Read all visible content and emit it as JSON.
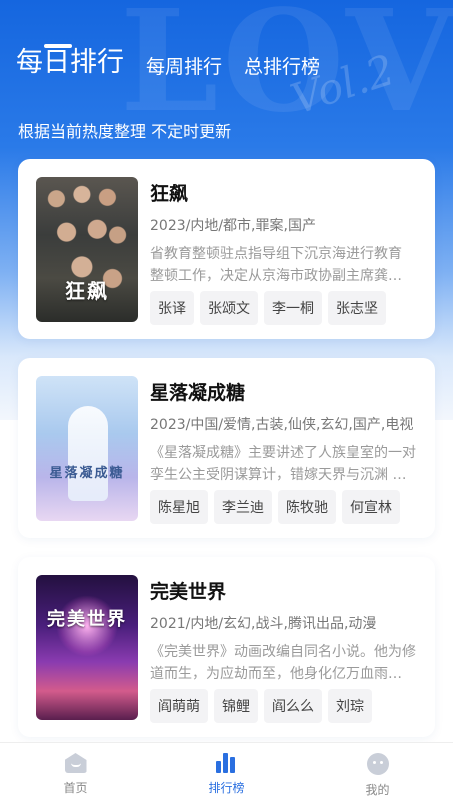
{
  "header": {
    "tabs": [
      {
        "label": "每日排行",
        "active": true
      },
      {
        "label": "每周排行",
        "active": false
      },
      {
        "label": "总排行榜",
        "active": false
      }
    ],
    "subtitle": "根据当前热度整理 不定时更新"
  },
  "items": [
    {
      "title": "狂飙",
      "meta": "2023/内地/都市,罪案,国产",
      "desc_line1": "省教育整顿驻点指导组下沉京海进行教育",
      "desc_line2": "整顿工作，决定从京海市政协副主席龚…",
      "cast": [
        "张译",
        "张颂文",
        "李一桐",
        "张志坚"
      ],
      "poster_text": "狂飙"
    },
    {
      "title": "星落凝成糖",
      "meta": "2023/中国/爱情,古装,仙侠,玄幻,国产,电视",
      "desc_line1": "《星落凝成糖》主要讲述了人族皇室的一对",
      "desc_line2": "孪生公主受阴谋算计，错嫁天界与沉渊 …",
      "cast": [
        "陈星旭",
        "李兰迪",
        "陈牧驰",
        "何宣林"
      ],
      "poster_text": "星落凝成糖"
    },
    {
      "title": "完美世界",
      "meta": "2021/内地/玄幻,战斗,腾讯出品,动漫",
      "desc_line1": "《完美世界》动画改编自同名小说。他为修",
      "desc_line2": "道而生，为应劫而至，他身化亿万血雨…",
      "cast": [
        "阎萌萌",
        "锦鲤",
        "阎么么",
        "刘琮"
      ],
      "poster_text": "完美世界"
    }
  ],
  "tabbar": [
    {
      "label": "首页",
      "icon": "home-icon",
      "active": false
    },
    {
      "label": "排行榜",
      "icon": "chart-icon",
      "active": true
    },
    {
      "label": "我的",
      "icon": "profile-icon",
      "active": false
    }
  ],
  "colors": {
    "accent": "#2a6fe0",
    "hero": "#1566df"
  }
}
